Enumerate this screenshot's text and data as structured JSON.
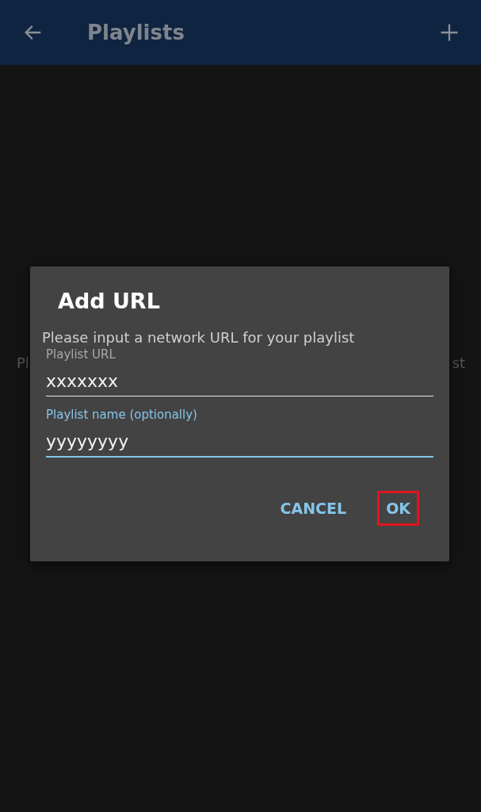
{
  "app_bar": {
    "title": "Playlists"
  },
  "background_hint": {
    "left": "Pl",
    "right": "st"
  },
  "dialog": {
    "title": "Add URL",
    "message": "Please input a network URL for your playlist",
    "fields": [
      {
        "label": "Playlist URL",
        "value": "xxxxxxx",
        "focused": false
      },
      {
        "label": "Playlist name (optionally)",
        "value": "yyyyyyyy",
        "focused": true
      }
    ],
    "buttons": [
      {
        "label": "CANCEL",
        "highlighted": false
      },
      {
        "label": "OK",
        "highlighted": true
      }
    ]
  }
}
